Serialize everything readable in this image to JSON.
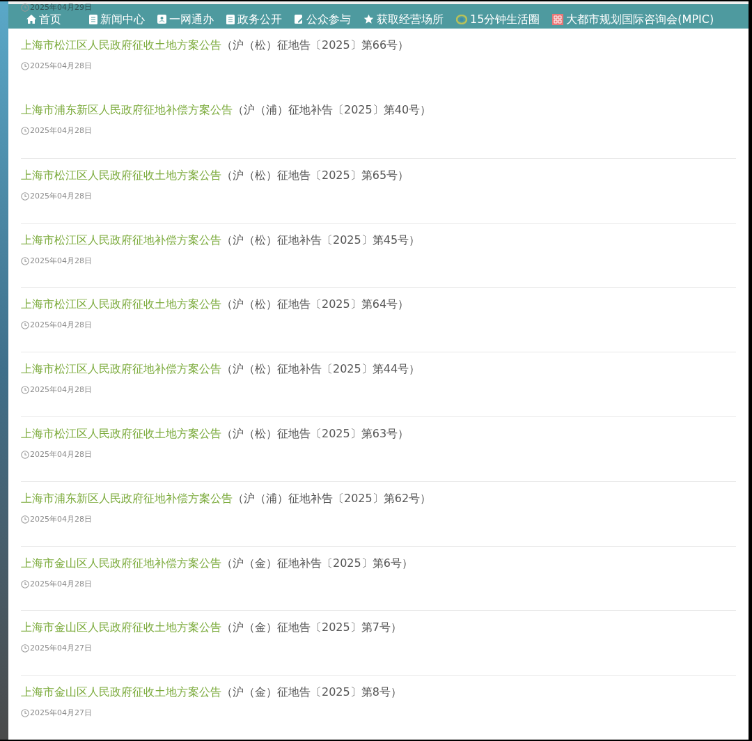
{
  "nav": [
    {
      "label": "首页"
    },
    {
      "label": "新闻中心"
    },
    {
      "label": "一网通办"
    },
    {
      "label": "政务公开"
    },
    {
      "label": "公众参与"
    },
    {
      "label": "获取经营场所"
    },
    {
      "label": "15分钟生活圈"
    },
    {
      "label": "大都市规划国际咨询会(MPIC)"
    }
  ],
  "partial_date": "2025年04月29日",
  "notices": [
    {
      "title": "上海市松江区人民政府征收土地方案公告",
      "number": "（沪（松）征地告〔2025〕第66号）",
      "date": "2025年04月28日"
    },
    {
      "title": "上海市浦东新区人民政府征地补偿方案公告",
      "number": "（沪（浦）征地补告〔2025〕第40号）",
      "date": "2025年04月28日"
    },
    {
      "title": "上海市松江区人民政府征收土地方案公告",
      "number": "（沪（松）征地告〔2025〕第65号）",
      "date": "2025年04月28日"
    },
    {
      "title": "上海市松江区人民政府征地补偿方案公告",
      "number": "（沪（松）征地补告〔2025〕第45号）",
      "date": "2025年04月28日"
    },
    {
      "title": "上海市松江区人民政府征收土地方案公告",
      "number": "（沪（松）征地告〔2025〕第64号）",
      "date": "2025年04月28日"
    },
    {
      "title": "上海市松江区人民政府征地补偿方案公告",
      "number": "（沪（松）征地补告〔2025〕第44号）",
      "date": "2025年04月28日"
    },
    {
      "title": "上海市松江区人民政府征收土地方案公告",
      "number": "（沪（松）征地告〔2025〕第63号）",
      "date": "2025年04月28日"
    },
    {
      "title": "上海市浦东新区人民政府征地补偿方案公告",
      "number": "（沪（浦）征地补告〔2025〕第62号）",
      "date": "2025年04月28日"
    },
    {
      "title": "上海市金山区人民政府征地补偿方案公告",
      "number": "（沪（金）征地补告〔2025〕第6号）",
      "date": "2025年04月28日"
    },
    {
      "title": "上海市金山区人民政府征收土地方案公告",
      "number": "（沪（金）征地告〔2025〕第7号）",
      "date": "2025年04月27日"
    },
    {
      "title": "上海市金山区人民政府征收土地方案公告",
      "number": "（沪（金）征地告〔2025〕第8号）",
      "date": "2025年04月27日"
    }
  ]
}
